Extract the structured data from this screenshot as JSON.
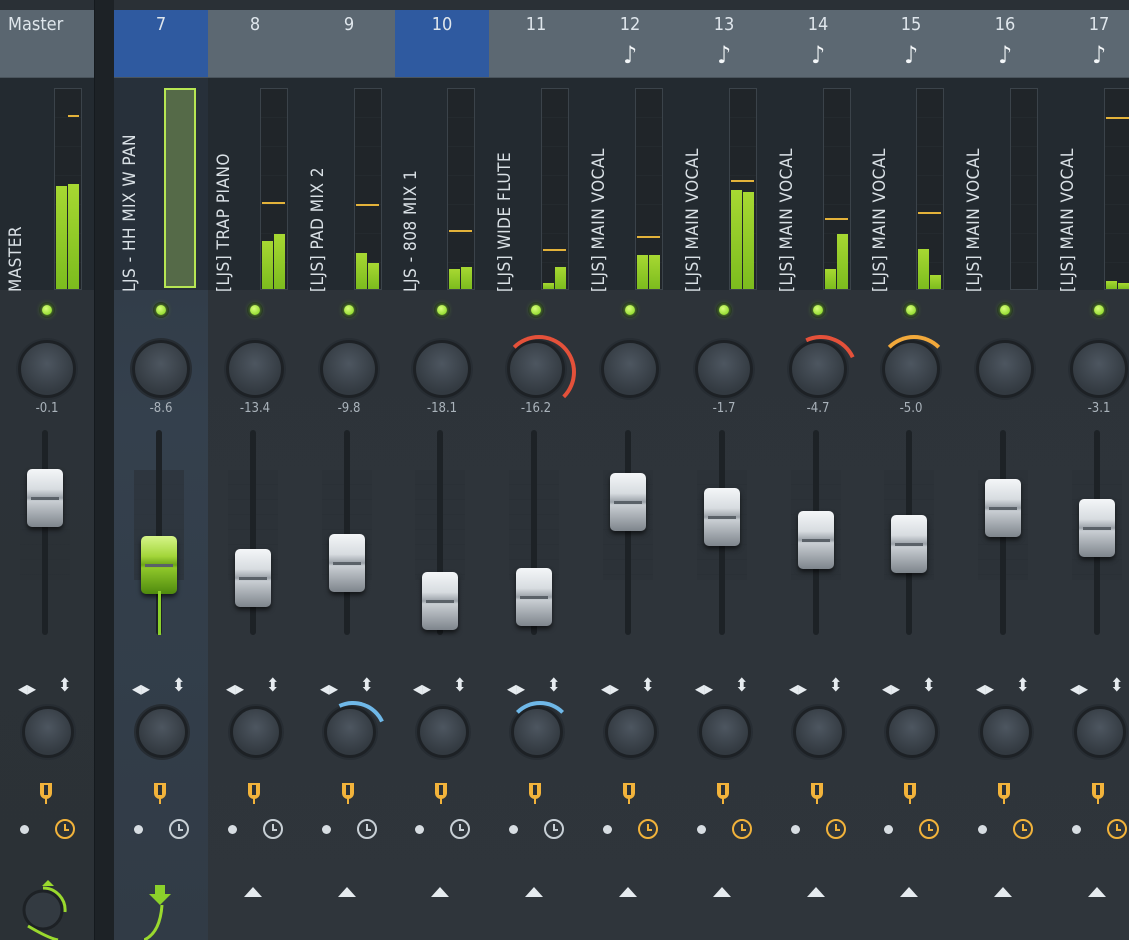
{
  "master": {
    "header": "Master",
    "label": "MASTER",
    "volume": "-0.1",
    "meter": {
      "l": 0.52,
      "r": 0.53,
      "peak": 0.87
    },
    "fader_level": 0.9
  },
  "strips": [
    {
      "num": "7",
      "label": "LJS - HH MIX W PAN",
      "volume": "-8.6",
      "note": false,
      "selected": true,
      "header_selected": true,
      "send": true,
      "fader_level": 0.55,
      "pan_arc": "",
      "stereo_arc": "",
      "clock": "grey",
      "route": "green"
    },
    {
      "num": "8",
      "label": "[LJS] TRAP PIANO",
      "volume": "-13.4",
      "note": false,
      "meter": {
        "l": 0.24,
        "r": 0.28,
        "peak": 0.43
      },
      "fader_level": 0.48,
      "pan_arc": "",
      "stereo_arc": "",
      "clock": "grey"
    },
    {
      "num": "9",
      "label": "[LJS] PAD MIX 2",
      "volume": "-9.8",
      "note": false,
      "meter": {
        "l": 0.18,
        "r": 0.13,
        "peak": 0.42
      },
      "fader_level": 0.56,
      "pan_arc": "",
      "stereo_arc": "blue-small",
      "clock": "grey"
    },
    {
      "num": "10",
      "label": "LJS - 808 MIX 1",
      "volume": "-18.1",
      "note": false,
      "header_selected": true,
      "meter": {
        "l": 0.1,
        "r": 0.11,
        "peak": 0.29
      },
      "fader_level": 0.36,
      "pan_arc": "",
      "stereo_arc": "",
      "clock": "grey"
    },
    {
      "num": "11",
      "label": "[LJS] WIDE FLUTE",
      "volume": "-16.2",
      "note": false,
      "meter": {
        "l": 0.03,
        "r": 0.11,
        "peak": 0.19
      },
      "fader_level": 0.38,
      "pan_arc": "red",
      "stereo_arc": "blue",
      "clock": "grey"
    },
    {
      "num": "12",
      "label": "[LJS] MAIN VOCAL",
      "volume": "",
      "note": true,
      "meter": {
        "l": 0.17,
        "r": 0.17,
        "peak": 0.26
      },
      "fader_level": 0.88,
      "pan_arc": "",
      "stereo_arc": "",
      "clock": "orange"
    },
    {
      "num": "13",
      "label": "[LJS] MAIN VOCAL",
      "volume": "-1.7",
      "note": true,
      "meter": {
        "l": 0.5,
        "r": 0.49,
        "peak": 0.54
      },
      "fader_level": 0.8,
      "pan_arc": "",
      "stereo_arc": "",
      "clock": "orange"
    },
    {
      "num": "14",
      "label": "[LJS] MAIN VOCAL",
      "volume": "-4.7",
      "note": true,
      "meter": {
        "l": 0.1,
        "r": 0.28,
        "peak": 0.35
      },
      "fader_level": 0.68,
      "pan_arc": "red-small",
      "stereo_arc": "",
      "clock": "orange"
    },
    {
      "num": "15",
      "label": "[LJS] MAIN VOCAL",
      "volume": "-5.0",
      "note": true,
      "meter": {
        "l": 0.2,
        "r": 0.07,
        "peak": 0.38
      },
      "fader_level": 0.66,
      "pan_arc": "orange",
      "stereo_arc": "",
      "clock": "orange"
    },
    {
      "num": "16",
      "label": "[LJS] MAIN VOCAL",
      "volume": "",
      "note": true,
      "meter": {
        "l": 0,
        "r": 0,
        "peak": 0
      },
      "fader_level": 0.85,
      "pan_arc": "",
      "stereo_arc": "",
      "clock": "orange"
    },
    {
      "num": "17",
      "label": "[LJS] MAIN VOCAL",
      "volume": "-3.1",
      "note": true,
      "meter": {
        "l": 0.04,
        "r": 0.03,
        "peak": 0.86
      },
      "fader_level": 0.74,
      "pan_arc": "",
      "stereo_arc": "",
      "clock": "orange"
    }
  ],
  "icons": {
    "note_icon": "♪",
    "pan_icon": "◂▸",
    "updown_icon": "⬍"
  },
  "colors": {
    "accent_green": "#9ad92e",
    "selected_header": "#2f5aa0",
    "clock_orange": "#f2b33b",
    "arc_red": "#e4513a",
    "arc_orange": "#f2a93b",
    "arc_blue": "#6fb8e8"
  }
}
